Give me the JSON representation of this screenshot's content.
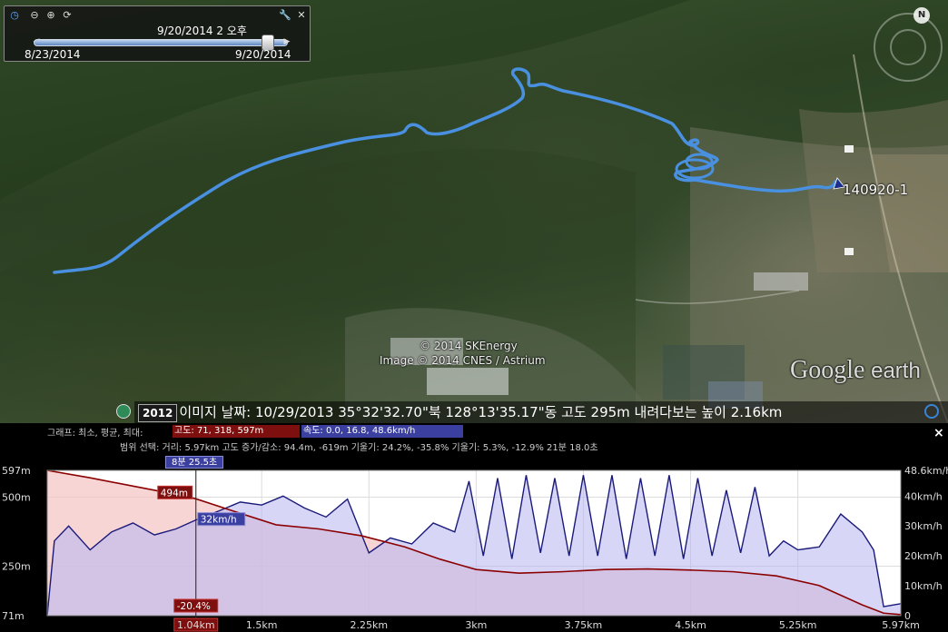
{
  "time_slider": {
    "current": "9/20/2014   2 오후",
    "start": "8/23/2014",
    "end": "9/20/2014",
    "position": 0.92
  },
  "map": {
    "placemark_label": "140920-1",
    "copyright_1": "© 2014 SKEnergy",
    "copyright_2": "Image © 2014 CNES / Astrium",
    "logo_google": "Google",
    "logo_earth": " earth"
  },
  "status": {
    "year": "2012",
    "text": "이미지 날짜: 10/29/2013     35°32'32.70\"북 128°13'35.17\"동 고도    295m     내려다보는 높이    2.16km"
  },
  "profile": {
    "graph_label": "그래프: 최소, 평균, 최대:",
    "altitude_label": "고도: 71, 318, 597m",
    "speed_label": "속도: 0.0, 16.8, 48.6km/h",
    "range_label": "범위 선택: 거리: 5.97km 고도 증가/감소: 94.4m, -619m 기울기: 24.2%, -35.8% 기울기: 5.3%, -12.9% 21분 18.0초",
    "selected_time": "8분 25.5초",
    "close": "×",
    "cursor_altitude": "494m",
    "cursor_speed": "32km/h",
    "cursor_slope": "-20.4%",
    "cursor_distance": "1.04km"
  },
  "chart_data": {
    "type": "line",
    "x_ticks": [
      "1.04km",
      "1.5km",
      "2.25km",
      "3km",
      "3.75km",
      "4.5km",
      "5.25km",
      "5.97km"
    ],
    "x_tick_values": [
      1.04,
      1.5,
      2.25,
      3.0,
      3.75,
      4.5,
      5.25,
      5.97
    ],
    "xlim": [
      0,
      5.97
    ],
    "y_left_ticks": [
      "597m",
      "500m",
      "250m",
      "71m"
    ],
    "y_left_tick_values": [
      597,
      500,
      250,
      71
    ],
    "ylim_left": [
      71,
      597
    ],
    "y_right_ticks": [
      "48.6km/h",
      "40km/h",
      "30km/h",
      "20km/h",
      "10km/h",
      "0"
    ],
    "y_right_tick_values": [
      48.6,
      40,
      30,
      20,
      10,
      0
    ],
    "ylim_right": [
      0,
      48.6
    ],
    "series": [
      {
        "name": "고도",
        "color": "#8b0000",
        "x": [
          0,
          0.3,
          0.6,
          0.9,
          1.04,
          1.3,
          1.6,
          1.9,
          2.2,
          2.5,
          2.75,
          3.0,
          3.3,
          3.6,
          3.9,
          4.2,
          4.5,
          4.8,
          5.1,
          5.4,
          5.7,
          5.85,
          5.97
        ],
        "values": [
          597,
          570,
          540,
          510,
          494,
          450,
          400,
          385,
          360,
          320,
          275,
          238,
          225,
          230,
          238,
          240,
          236,
          230,
          215,
          180,
          110,
          80,
          75
        ]
      },
      {
        "name": "속도",
        "color": "#1a1a7a",
        "x": [
          0,
          0.05,
          0.15,
          0.3,
          0.45,
          0.6,
          0.75,
          0.9,
          1.04,
          1.2,
          1.35,
          1.5,
          1.65,
          1.8,
          1.95,
          2.1,
          2.25,
          2.4,
          2.55,
          2.7,
          2.85,
          2.95,
          3.05,
          3.15,
          3.25,
          3.35,
          3.45,
          3.55,
          3.65,
          3.75,
          3.85,
          3.95,
          4.05,
          4.15,
          4.25,
          4.35,
          4.45,
          4.55,
          4.65,
          4.75,
          4.85,
          4.95,
          5.05,
          5.15,
          5.25,
          5.4,
          5.55,
          5.7,
          5.78,
          5.85,
          5.97
        ],
        "values": [
          0,
          25,
          30,
          22,
          28,
          31,
          27,
          29,
          32,
          35,
          38,
          37,
          40,
          36,
          33,
          39,
          21,
          26,
          24,
          31,
          28,
          45,
          20,
          46,
          19,
          47,
          21,
          46,
          20,
          47,
          20,
          47,
          19,
          46,
          20,
          47,
          19,
          46,
          20,
          42,
          21,
          43,
          20,
          25,
          22,
          23,
          34,
          28,
          22,
          3,
          4
        ]
      }
    ],
    "cursor_x": 1.04,
    "grid": true
  }
}
